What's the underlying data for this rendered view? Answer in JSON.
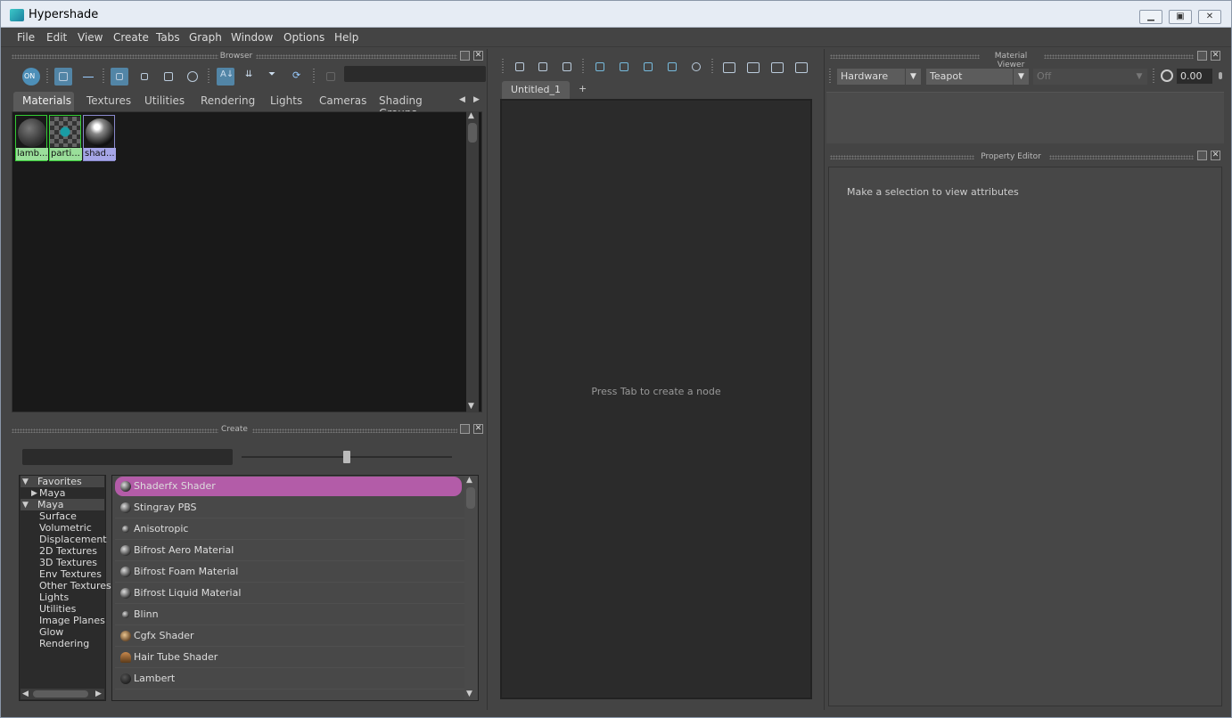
{
  "window": {
    "title": "Hypershade"
  },
  "menu": [
    "File",
    "Edit",
    "View",
    "Create",
    "Tabs",
    "Graph",
    "Window",
    "Options",
    "Help"
  ],
  "browser": {
    "title": "Browser",
    "tabs": [
      "Materials",
      "Textures",
      "Utilities",
      "Rendering",
      "Lights",
      "Cameras",
      "Shading Groups"
    ],
    "active_tab": "Materials",
    "swatches": [
      {
        "label": "lamb...",
        "bg": "#9adf9a"
      },
      {
        "label": "parti...",
        "bg": "#9adf9a"
      },
      {
        "label": "shad...",
        "bg": "#a6a6e8"
      }
    ],
    "on_label": "ON"
  },
  "create": {
    "title": "Create",
    "tree": [
      "Favorites",
      "Maya",
      "Maya",
      "Surface",
      "Volumetric",
      "Displacement",
      "2D Textures",
      "3D Textures",
      "Env Textures",
      "Other Textures",
      "Lights",
      "Utilities",
      "Image Planes",
      "Glow",
      "Rendering"
    ],
    "list": [
      "Shaderfx Shader",
      "Stingray PBS",
      "Anisotropic",
      "Bifrost Aero Material",
      "Bifrost Foam Material",
      "Bifrost Liquid Material",
      "Blinn",
      "Cgfx Shader",
      "Hair Tube Shader",
      "Lambert"
    ],
    "selected": "Shaderfx Shader",
    "selected_color": "#b35ca8"
  },
  "graph": {
    "tab": "Untitled_1",
    "add_tab": "+",
    "hint": "Press Tab to create a node"
  },
  "material_viewer": {
    "title": "Material Viewer",
    "renderer": "Hardware",
    "shape": "Teapot",
    "env": "Off",
    "exposure": "0.00"
  },
  "property_editor": {
    "title": "Property Editor",
    "hint": "Make a selection to view attributes"
  }
}
